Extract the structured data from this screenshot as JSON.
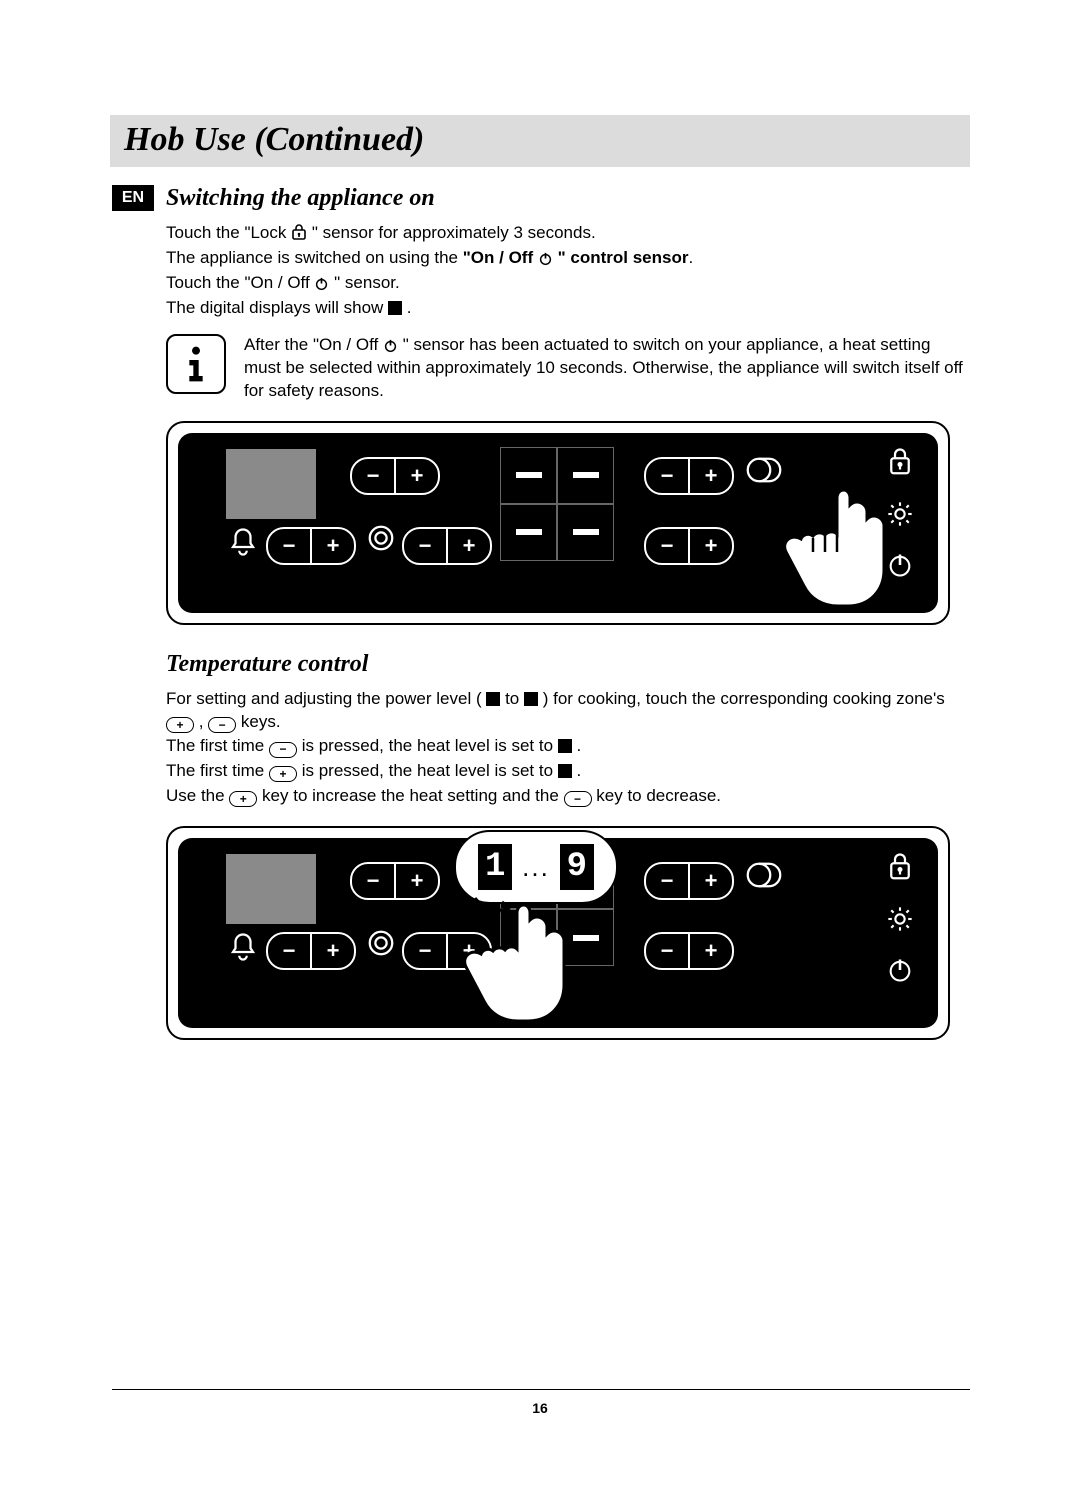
{
  "title": "Hob Use (Continued)",
  "lang_badge": "EN",
  "page_number": "16",
  "section_switching": {
    "heading": "Switching the appliance on",
    "p1a": "Touch the \"Lock ",
    "p1b": "\" sensor for approximately 3 seconds.",
    "p2a": "The appliance is switched on using the ",
    "p2b": "\"On / Off ",
    "p2c": "\" control sensor",
    "p2d": ".",
    "p3a": "Touch the \"On / Off ",
    "p3b": "\" sensor.",
    "p4a": "The digital displays will show ",
    "p4b": " .",
    "info_a": "After the \"On / Off ",
    "info_b": "\" sensor has been actuated to switch on your appliance, a heat setting must be selected within approximately 10 seconds. Otherwise, the appliance will switch itself off for safety reasons."
  },
  "section_temp": {
    "heading": "Temperature control",
    "p1a": "For setting and adjusting the power level ( ",
    "p1b": " to ",
    "p1c": " ) for cooking, touch the corresponding cooking zone's ",
    "p1d": ", ",
    "p1e": " keys.",
    "p2a": "The first time ",
    "p2b": " is pressed, the heat level is set to ",
    "p2c": " .",
    "p3a": "The first time ",
    "p3b": " is pressed, the heat level is set to ",
    "p3c": " .",
    "p4a": "Use the ",
    "p4b": " key to increase the heat setting and the ",
    "p4c": " key to decrease."
  },
  "callout": {
    "d1": "1",
    "dots": "...",
    "d2": "9"
  }
}
